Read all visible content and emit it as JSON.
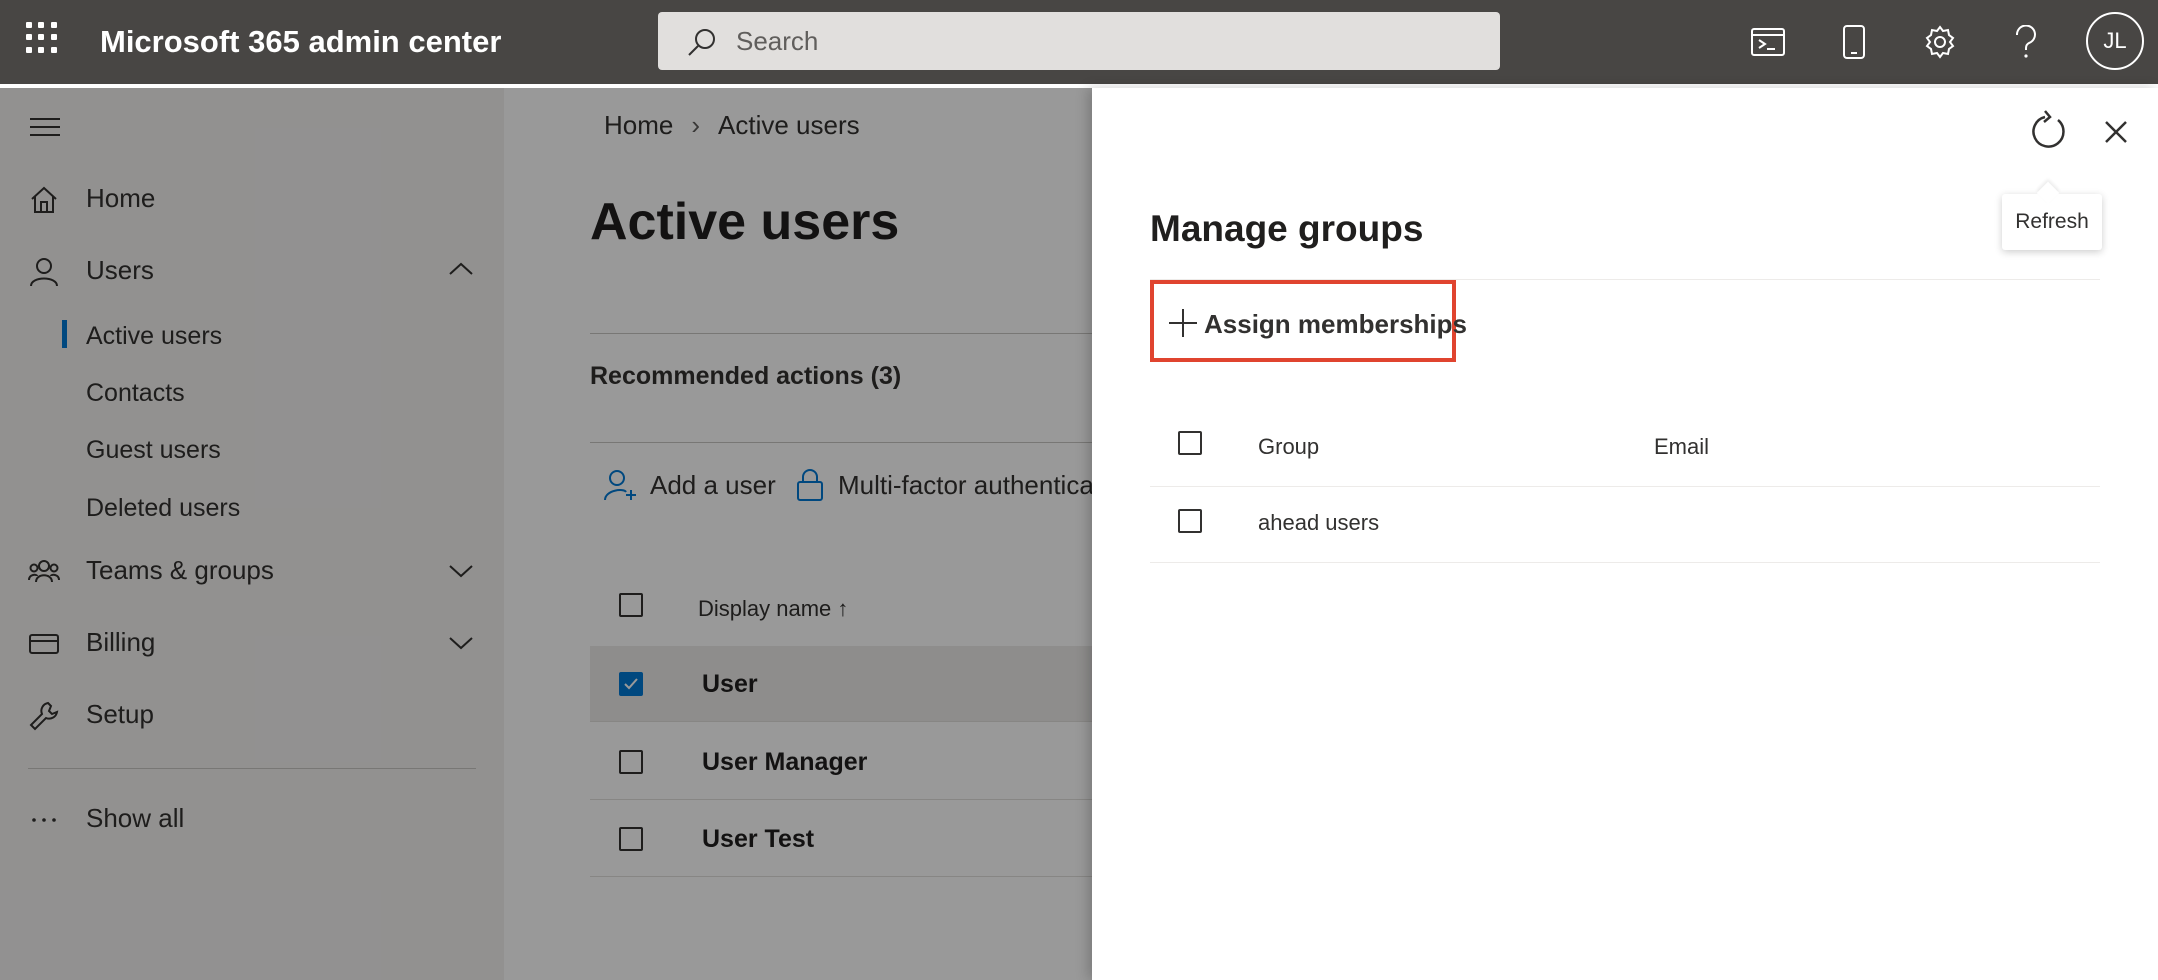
{
  "topbar": {
    "app_title": "Microsoft 365 admin center",
    "search_placeholder": "Search",
    "avatar_initials": "JL",
    "icons": [
      "waffle-icon",
      "search-icon",
      "terminal-icon",
      "mobile-icon",
      "gear-icon",
      "help-icon"
    ]
  },
  "nav": {
    "items": [
      {
        "label": "Home",
        "icon": "home-icon"
      },
      {
        "label": "Users",
        "icon": "user-icon"
      },
      {
        "label": "Teams & groups",
        "icon": "teams-icon"
      },
      {
        "label": "Billing",
        "icon": "billing-icon"
      },
      {
        "label": "Setup",
        "icon": "wrench-icon"
      }
    ],
    "users_sub": [
      "Active users",
      "Contacts",
      "Guest users",
      "Deleted users"
    ],
    "show_all": "Show all"
  },
  "main": {
    "breadcrumb": [
      "Home",
      "Active users"
    ],
    "title": "Active users",
    "recommended": "Recommended actions (3)",
    "commands": {
      "add_user": "Add a user",
      "mfa": "Multi-factor authentica"
    },
    "table_header": "Display name",
    "rows": [
      {
        "name": "User",
        "selected": true
      },
      {
        "name": "User Manager",
        "selected": false
      },
      {
        "name": "User Test",
        "selected": false
      }
    ]
  },
  "panel": {
    "title": "Manage groups",
    "tooltip": "Refresh",
    "assign_label": "Assign memberships",
    "columns": {
      "group": "Group",
      "email": "Email"
    },
    "groups": [
      {
        "group": "ahead users",
        "email": ""
      }
    ],
    "accent": "#e0442f"
  }
}
